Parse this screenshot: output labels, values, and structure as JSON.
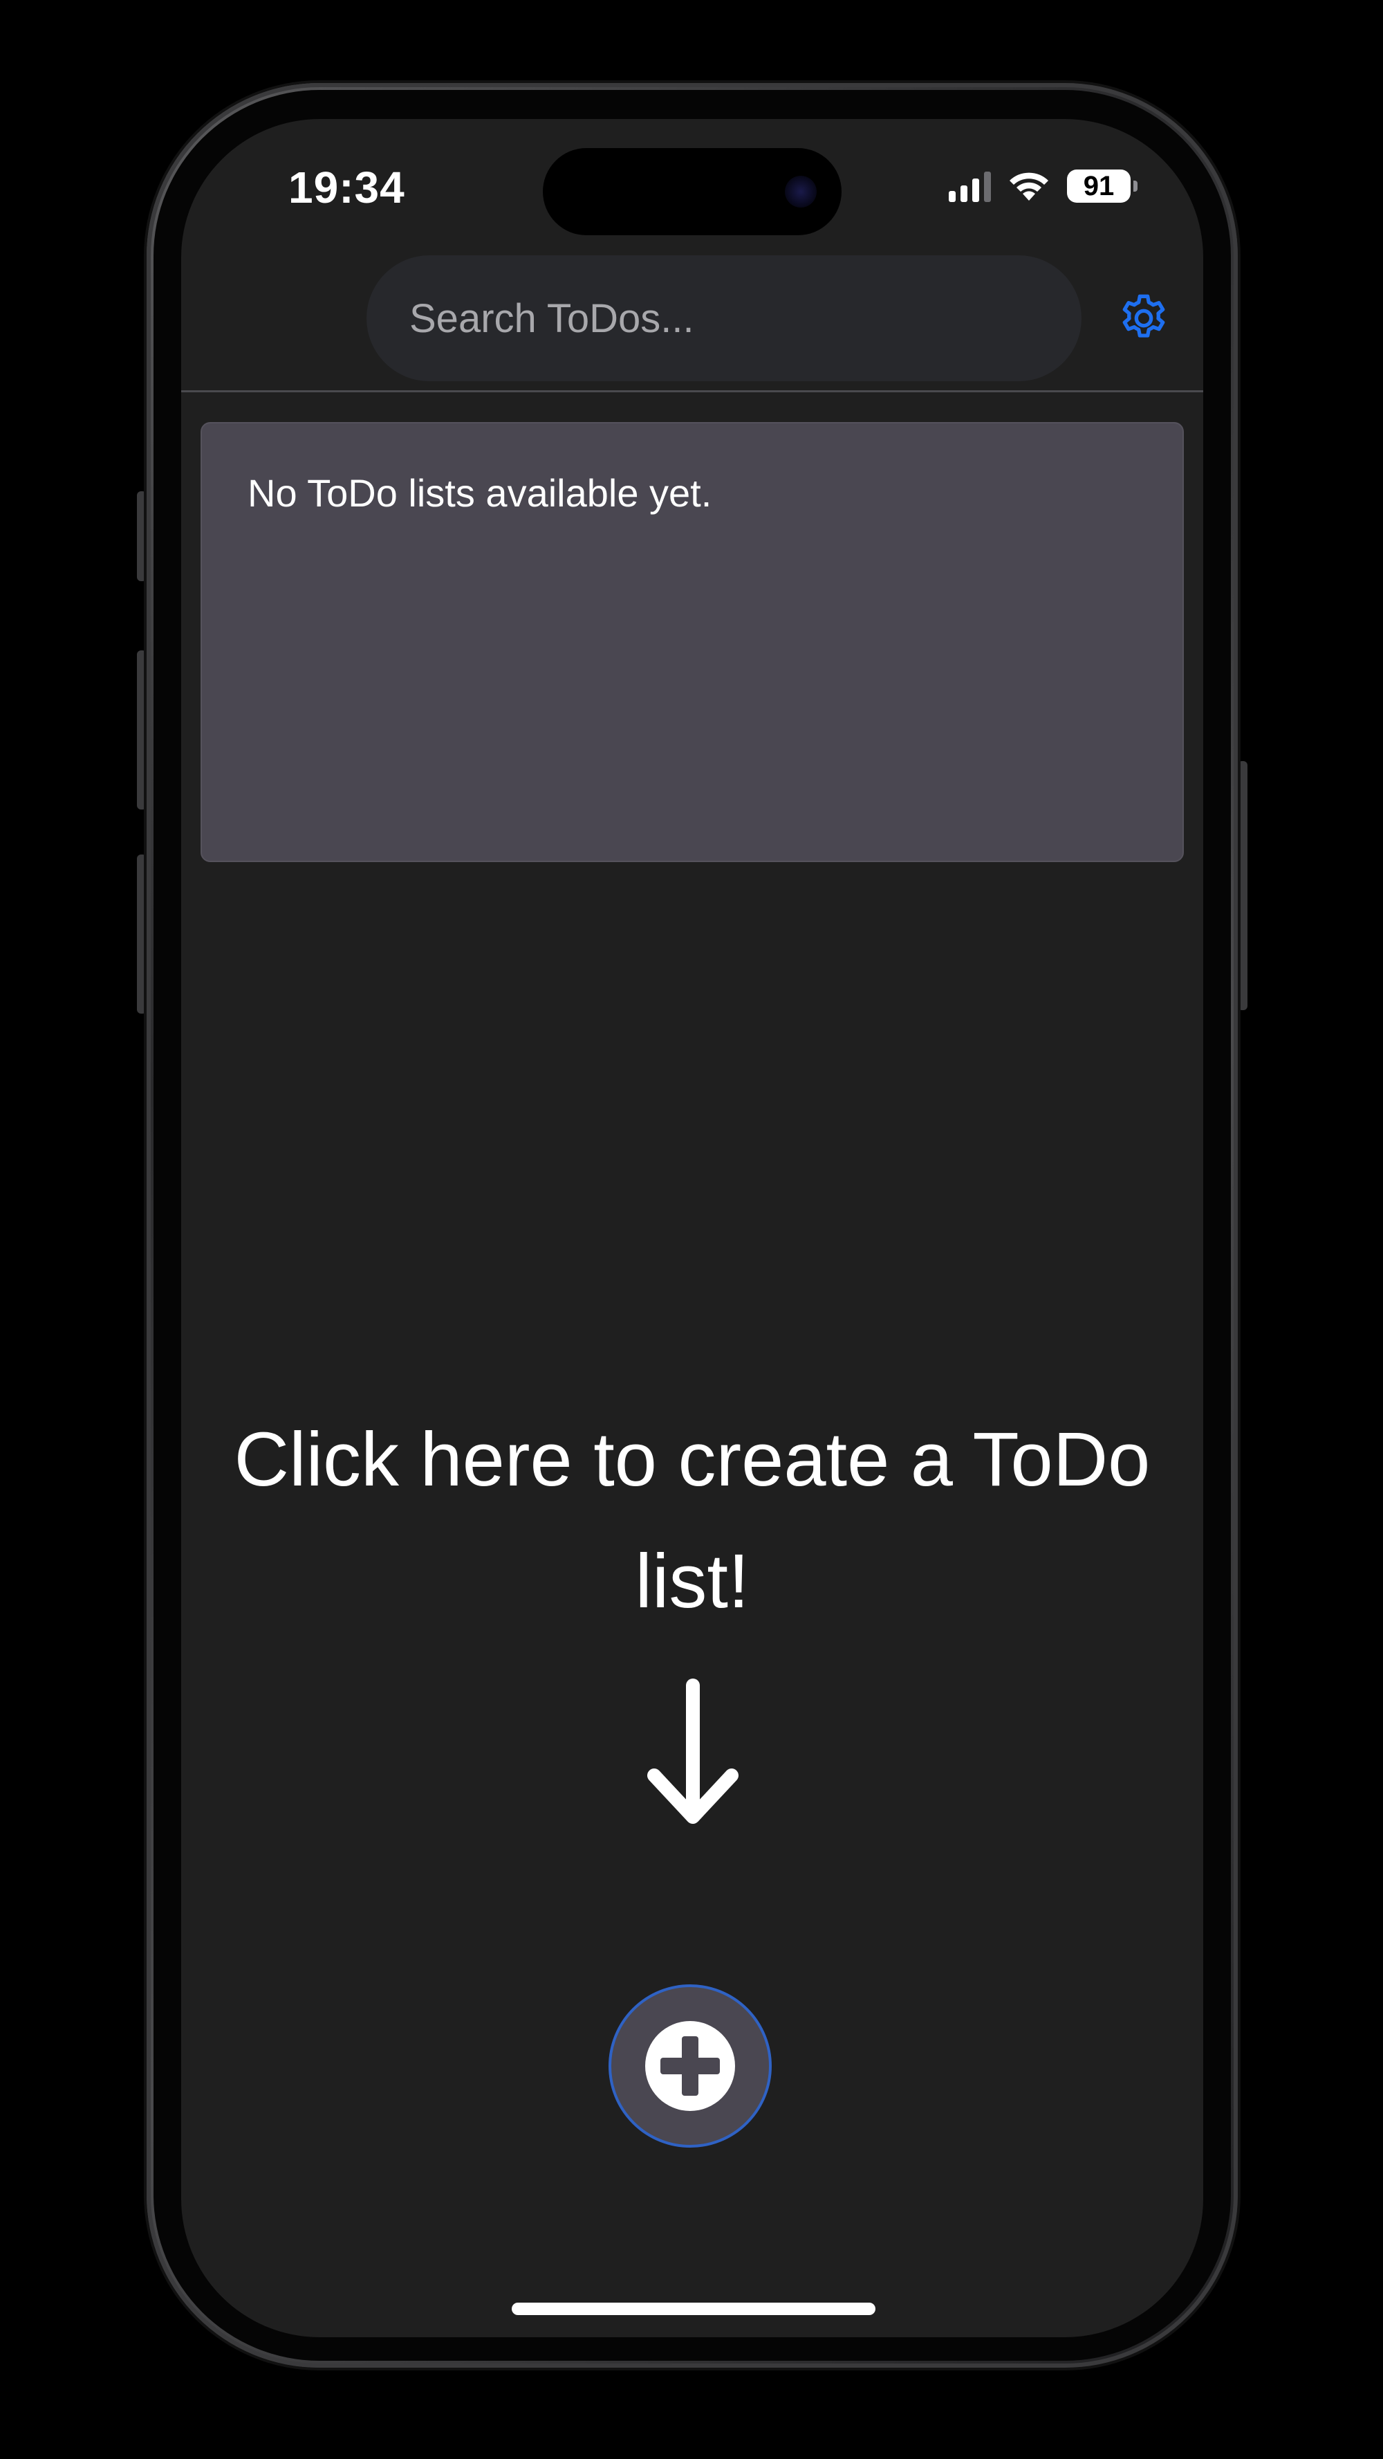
{
  "status_bar": {
    "time": "19:34",
    "battery_level": "91",
    "signal_icon": "cellular-signal-icon",
    "wifi_icon": "wifi-icon"
  },
  "header": {
    "search_placeholder": "Search ToDos...",
    "search_value": "",
    "settings_icon": "gear-icon"
  },
  "main": {
    "empty_message": "No ToDo lists available yet.",
    "prompt_text": "Click here to create a ToDo list!",
    "arrow_icon": "arrow-down-icon",
    "add_button_icon": "plus-circle-icon"
  },
  "colors": {
    "accent": "#1e6ff0",
    "background": "#1f1f1f",
    "card": "#4a4751",
    "button_border": "#2f62c4"
  }
}
